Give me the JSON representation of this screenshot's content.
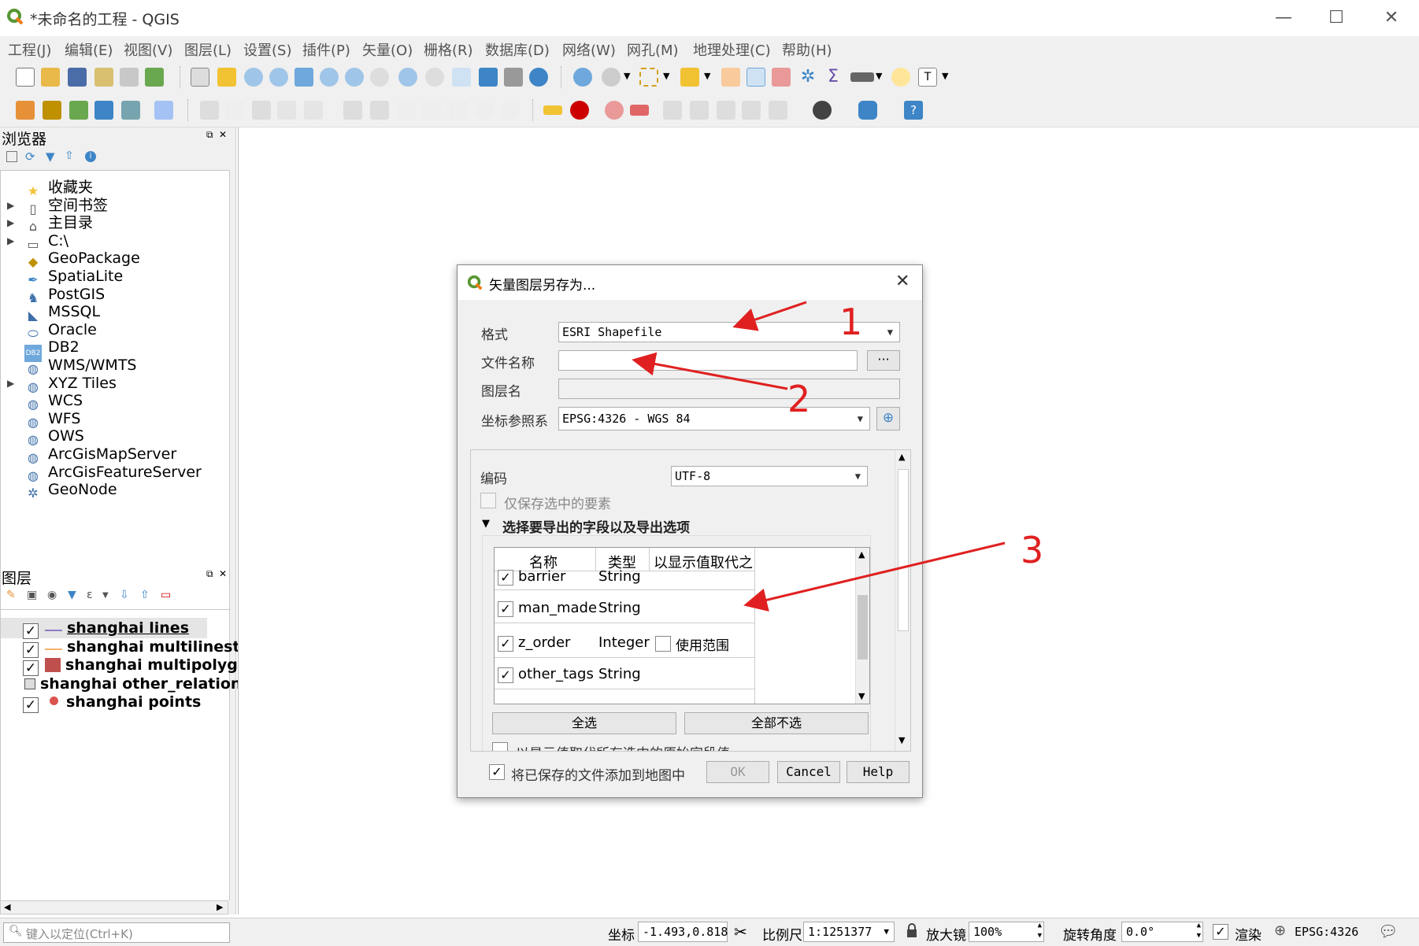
{
  "window": {
    "title": "*未命名的工程 - QGIS"
  },
  "menu": [
    "工程(J)",
    "编辑(E)",
    "视图(V)",
    "图层(L)",
    "设置(S)",
    "插件(P)",
    "矢量(O)",
    "栅格(R)",
    "数据库(D)",
    "网络(W)",
    "网孔(M)",
    "地理处理(C)",
    "帮助(H)"
  ],
  "browser": {
    "title": "浏览器",
    "items": [
      {
        "label": "收藏夹",
        "icon": "star-icon",
        "expander": false
      },
      {
        "label": "空间书签",
        "icon": "bookmark-icon",
        "expander": true
      },
      {
        "label": "主目录",
        "icon": "home-icon",
        "expander": true
      },
      {
        "label": "C:\\",
        "icon": "folder-icon",
        "expander": true
      },
      {
        "label": "GeoPackage",
        "icon": "geopackage-icon",
        "expander": false
      },
      {
        "label": "SpatiaLite",
        "icon": "spatialite-icon",
        "expander": false
      },
      {
        "label": "PostGIS",
        "icon": "postgis-icon",
        "expander": false
      },
      {
        "label": "MSSQL",
        "icon": "mssql-icon",
        "expander": false
      },
      {
        "label": "Oracle",
        "icon": "oracle-icon",
        "expander": false
      },
      {
        "label": "DB2",
        "icon": "db2-icon",
        "expander": false
      },
      {
        "label": "WMS/WMTS",
        "icon": "wms-icon",
        "expander": false
      },
      {
        "label": "XYZ Tiles",
        "icon": "xyz-icon",
        "expander": true
      },
      {
        "label": "WCS",
        "icon": "wcs-icon",
        "expander": false
      },
      {
        "label": "WFS",
        "icon": "wfs-icon",
        "expander": false
      },
      {
        "label": "OWS",
        "icon": "ows-icon",
        "expander": false
      },
      {
        "label": "ArcGisMapServer",
        "icon": "arcgis-map-icon",
        "expander": false
      },
      {
        "label": "ArcGisFeatureServer",
        "icon": "arcgis-feature-icon",
        "expander": false
      },
      {
        "label": "GeoNode",
        "icon": "geonode-icon",
        "expander": false
      }
    ],
    "db2_badge": "DB2"
  },
  "layers": {
    "title": "图层",
    "items": [
      {
        "label": "shanghai lines",
        "checked": true,
        "symbol": "line-purple",
        "underline": true
      },
      {
        "label": "shanghai multilinestr",
        "checked": true,
        "symbol": "line-orange",
        "underline": false
      },
      {
        "label": "shanghai multipolygo",
        "checked": true,
        "symbol": "fill-red",
        "underline": false
      },
      {
        "label": "shanghai other_relations",
        "checked": false,
        "symbol": "table",
        "underline": false
      },
      {
        "label": "shanghai points",
        "checked": true,
        "symbol": "point-red",
        "underline": false
      }
    ]
  },
  "dialog": {
    "title": "矢量图层另存为...",
    "format_label": "格式",
    "format_value": "ESRI Shapefile",
    "filename_label": "文件名称",
    "filename_value": "",
    "browse_label": "···",
    "layername_label": "图层名",
    "crs_label": "坐标参照系",
    "crs_value": "EPSG:4326 - WGS 84",
    "encoding_label": "编码",
    "encoding_value": "UTF-8",
    "selected_only_label": "仅保存选中的要素",
    "fields_group_label": "选择要导出的字段以及导出选项",
    "table_headers": [
      "名称",
      "类型",
      "以显示值取代之"
    ],
    "fields": [
      {
        "name": "barrier",
        "type": "String",
        "checked": true,
        "extra": ""
      },
      {
        "name": "man_made",
        "type": "String",
        "checked": true,
        "extra": ""
      },
      {
        "name": "z_order",
        "type": "Integer",
        "checked": true,
        "extra": "使用范围"
      },
      {
        "name": "other_tags",
        "type": "String",
        "checked": true,
        "extra": ""
      }
    ],
    "select_all": "全选",
    "deselect_all": "全部不选",
    "replace_all_label": "以显示值取代所有选中的原始字段值",
    "add_to_map_label": "将已保存的文件添加到地图中",
    "ok": "OK",
    "cancel": "Cancel",
    "help": "Help"
  },
  "annotations": [
    "1",
    "2",
    "3"
  ],
  "status": {
    "locate_placeholder": "键入以定位(Ctrl+K)",
    "coord_label": "坐标",
    "coord_value": "-1.493,0.818",
    "scale_label": "比例尺",
    "scale_value": "1:1251377",
    "magnifier_label": "放大镜",
    "magnifier_value": "100%",
    "rotation_label": "旋转角度",
    "rotation_value": "0.0°",
    "render_label": "渲染",
    "crs_value": "EPSG:4326"
  },
  "colors": {
    "accent_red": "#e02020",
    "qgis_green": "#589632"
  }
}
